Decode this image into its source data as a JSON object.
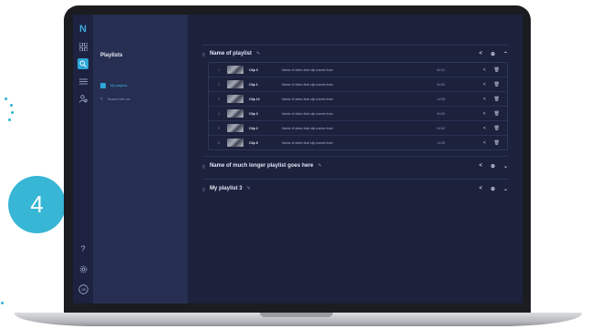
{
  "step_badge": "4",
  "app": {
    "rail_icons": [
      "app-logo-icon",
      "grid-icon",
      "search-icon",
      "list-icon",
      "users-icon"
    ],
    "sidebar": {
      "title": "Playlists",
      "items": [
        {
          "label": "My playlists",
          "active": true
        },
        {
          "label": "Shared with me",
          "active": false
        }
      ]
    },
    "playlists": [
      {
        "name": "Name of playlist",
        "expanded": true,
        "clips": [
          {
            "num": "1",
            "name": "Clip 3",
            "source": "Name of video that clip comes from",
            "duration": "04:31"
          },
          {
            "num": "2",
            "name": "Clip 1",
            "source": "Name of video that clip comes from",
            "duration": "04:52"
          },
          {
            "num": "3",
            "name": "Clip 12",
            "source": "Name of video that clip comes from",
            "duration": "14:55"
          },
          {
            "num": "4",
            "name": "Clip 3",
            "source": "Name of video that clip comes from",
            "duration": "04:50"
          },
          {
            "num": "5",
            "name": "Clip 2",
            "source": "Name of video that clip comes from",
            "duration": "04:52"
          },
          {
            "num": "6",
            "name": "Clip 8",
            "source": "Name of video that clip comes from",
            "duration": "14:55"
          }
        ]
      },
      {
        "name": "Name of much longer playlist goes here",
        "expanded": false,
        "clips": []
      },
      {
        "name": "My playlist 3",
        "expanded": false,
        "clips": []
      }
    ]
  },
  "colors": {
    "accent": "#2ea7d8",
    "badge": "#37b6d5",
    "screen_bg": "#1c213c",
    "sidebar_bg": "#262e52"
  }
}
